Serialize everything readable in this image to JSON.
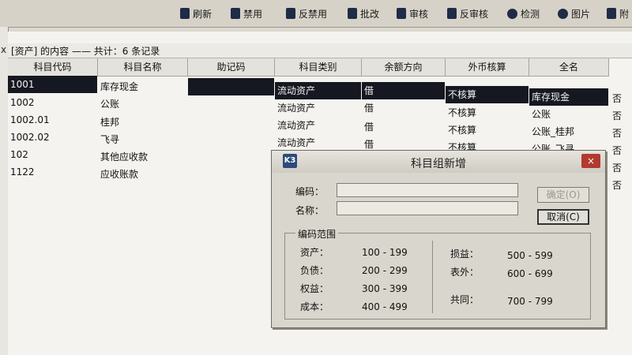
{
  "toolbar": {
    "items": [
      {
        "label": "刷新",
        "icon": "refresh-icon"
      },
      {
        "label": "禁用",
        "icon": "disable-icon"
      },
      {
        "label": "反禁用",
        "icon": "enable-icon"
      },
      {
        "label": "批改",
        "icon": "batch-edit-icon"
      },
      {
        "label": "审核",
        "icon": "audit-icon"
      },
      {
        "label": "反审核",
        "icon": "unaudit-icon"
      },
      {
        "label": "检测",
        "icon": "search-icon"
      },
      {
        "label": "图片",
        "icon": "chart-icon"
      },
      {
        "label": "附",
        "icon": "attach-icon"
      }
    ]
  },
  "window": {
    "close": "x"
  },
  "caption": {
    "text": "[资产] 的内容 —— 共计：6 条记录"
  },
  "grid": {
    "columns": [
      "科目代码",
      "科目名称",
      "助记码",
      "科目类别",
      "余额方向",
      "外币核算",
      "全名"
    ],
    "rows": [
      {
        "code": "1001",
        "name": "库存现金",
        "mnemonic": "",
        "category": "流动资产",
        "direction": "借",
        "forex": "不核算",
        "fullname": "库存现金",
        "flag": "否"
      },
      {
        "code": "1002",
        "name": "公账",
        "mnemonic": "",
        "category": "流动资产",
        "direction": "借",
        "forex": "不核算",
        "fullname": "公账",
        "flag": "否"
      },
      {
        "code": "1002.01",
        "name": "桂邦",
        "mnemonic": "",
        "category": "流动资产",
        "direction": "借",
        "forex": "不核算",
        "fullname": "公账_桂邦",
        "flag": "否"
      },
      {
        "code": "1002.02",
        "name": "飞寻",
        "mnemonic": "",
        "category": "流动资产",
        "direction": "借",
        "forex": "不核算",
        "fullname": "公账_飞寻",
        "flag": "否"
      },
      {
        "code": "102",
        "name": "其他应收款",
        "mnemonic": "",
        "category": "",
        "direction": "",
        "forex": "",
        "fullname": "",
        "flag": "否"
      },
      {
        "code": "1122",
        "name": "应收账款",
        "mnemonic": "",
        "category": "",
        "direction": "",
        "forex": "",
        "fullname": "",
        "flag": "否"
      }
    ]
  },
  "dialog": {
    "title": "科目组新增",
    "logo": "K3",
    "close_label": "×",
    "code_label": "编码：",
    "code_value": "",
    "name_label": "名称：",
    "name_value": "",
    "ok_label": "确定(O)",
    "cancel_label": "取消(C)",
    "range_legend": "编码范围",
    "ranges_left": [
      {
        "label": "资产：",
        "range": "100 - 199"
      },
      {
        "label": "负债：",
        "range": "200 - 299"
      },
      {
        "label": "权益：",
        "range": "300 - 399"
      },
      {
        "label": "成本：",
        "range": "400 - 499"
      }
    ],
    "ranges_right": [
      {
        "label": "损益：",
        "range": "500 - 599"
      },
      {
        "label": "表外：",
        "range": "600 - 699"
      },
      {
        "label": "共同：",
        "range": "700 - 799"
      }
    ]
  }
}
